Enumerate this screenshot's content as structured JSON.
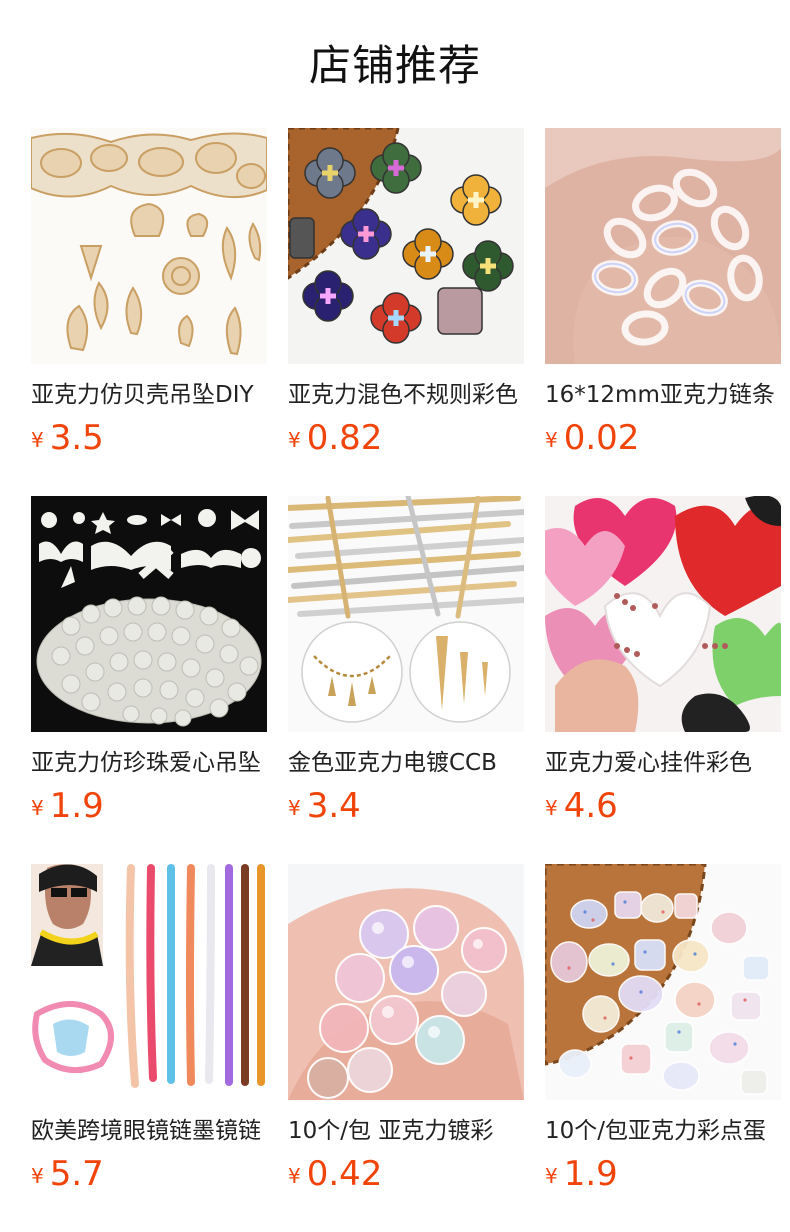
{
  "header": {
    "title": "店铺推荐"
  },
  "currency": "¥",
  "products": [
    {
      "name": "亚克力仿贝壳吊坠DIY",
      "price": "3.5",
      "image_icon": "seashell-pendants-icon"
    },
    {
      "name": "亚克力混色不规则彩色",
      "price": "0.82",
      "image_icon": "clover-beads-icon"
    },
    {
      "name": "16*12mm亚克力链条",
      "price": "0.02",
      "image_icon": "clear-chain-links-icon"
    },
    {
      "name": "亚克力仿珍珠爱心吊坠",
      "price": "1.9",
      "image_icon": "pearl-charms-icon"
    },
    {
      "name": "金色亚克力电镀CCB",
      "price": "3.4",
      "image_icon": "gold-spike-charms-icon"
    },
    {
      "name": "亚克力爱心挂件彩色",
      "price": "4.6",
      "image_icon": "heart-pendants-icon"
    },
    {
      "name": "欧美跨境眼镜链墨镜链",
      "price": "5.7",
      "image_icon": "glasses-chains-icon"
    },
    {
      "name": "10个/包 亚克力镀彩",
      "price": "0.42",
      "image_icon": "iridescent-beads-icon"
    },
    {
      "name": "10个/包亚克力彩点蛋",
      "price": "1.9",
      "image_icon": "speckled-beads-icon"
    }
  ]
}
